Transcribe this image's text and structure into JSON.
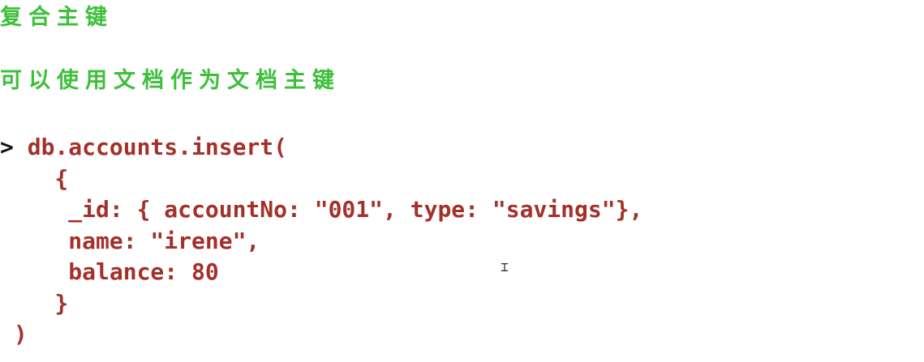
{
  "headings": {
    "title": "复合主键",
    "subtitle": "可以使用文档作为文档主键"
  },
  "code": {
    "prompt": ">",
    "lines": [
      " db.accounts.insert(",
      "    {",
      "     _id: { accountNo: \"001\", type: \"savings\"},",
      "     name: \"irene\",",
      "     balance: 80",
      "    }",
      " )"
    ]
  },
  "colors": {
    "heading": "#3cc03a",
    "code": "#a3312a",
    "prompt": "#111111",
    "background": "#ffffff"
  },
  "icons": {
    "cursor": "text-cursor-icon"
  }
}
